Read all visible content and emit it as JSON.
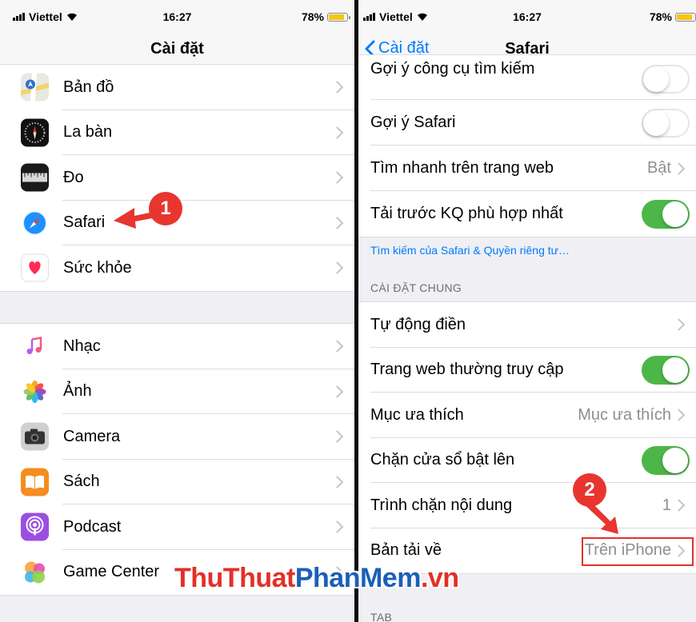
{
  "status": {
    "carrier": "Viettel",
    "time": "16:27",
    "battery": "78%",
    "battery_level": 0.78
  },
  "left": {
    "title": "Cài đặt",
    "group1": [
      {
        "label": "Bản đồ",
        "icon": "maps-icon"
      },
      {
        "label": "La bàn",
        "icon": "compass-icon"
      },
      {
        "label": "Đo",
        "icon": "measure-icon"
      },
      {
        "label": "Safari",
        "icon": "safari-icon"
      },
      {
        "label": "Sức khỏe",
        "icon": "health-icon"
      }
    ],
    "group2": [
      {
        "label": "Nhạc",
        "icon": "music-icon"
      },
      {
        "label": "Ảnh",
        "icon": "photos-icon"
      },
      {
        "label": "Camera",
        "icon": "camera-icon"
      },
      {
        "label": "Sách",
        "icon": "books-icon"
      },
      {
        "label": "Podcast",
        "icon": "podcast-icon"
      },
      {
        "label": "Game Center",
        "icon": "game-center-icon"
      }
    ]
  },
  "right": {
    "back": "Cài đặt",
    "title": "Safari",
    "group1": [
      {
        "label": "Gợi ý công cụ tìm kiếm",
        "toggle": false
      },
      {
        "label": "Gợi ý Safari",
        "toggle": false
      },
      {
        "label": "Tìm nhanh trên trang web",
        "value": "Bật"
      },
      {
        "label": "Tải trước KQ phù hợp nhất",
        "toggle": true
      }
    ],
    "privacy_link": "Tìm kiếm của Safari & Quyền riêng tư…",
    "section_general": "CÀI ĐẶT CHUNG",
    "group2": [
      {
        "label": "Tự động điền",
        "value": ""
      },
      {
        "label": "Trang web thường truy cập",
        "toggle": true
      },
      {
        "label": "Mục ưa thích",
        "value": "Mục ưa thích"
      },
      {
        "label": "Chặn cửa sổ bật lên",
        "toggle": true
      },
      {
        "label": "Trình chặn nội dung",
        "value": "1"
      },
      {
        "label": "Bản tải về",
        "value": "Trên iPhone"
      }
    ],
    "section_tab": "TAB"
  },
  "annotations": {
    "step1": "1",
    "step2": "2",
    "highlight_color": "#e0302d"
  },
  "watermark": {
    "part1": "ThuThuat",
    "part2": "PhanMem",
    "part3": ".vn"
  },
  "colors": {
    "ios_blue": "#007aff",
    "toggle_on": "#4cb748",
    "badge": "#e8352f"
  }
}
